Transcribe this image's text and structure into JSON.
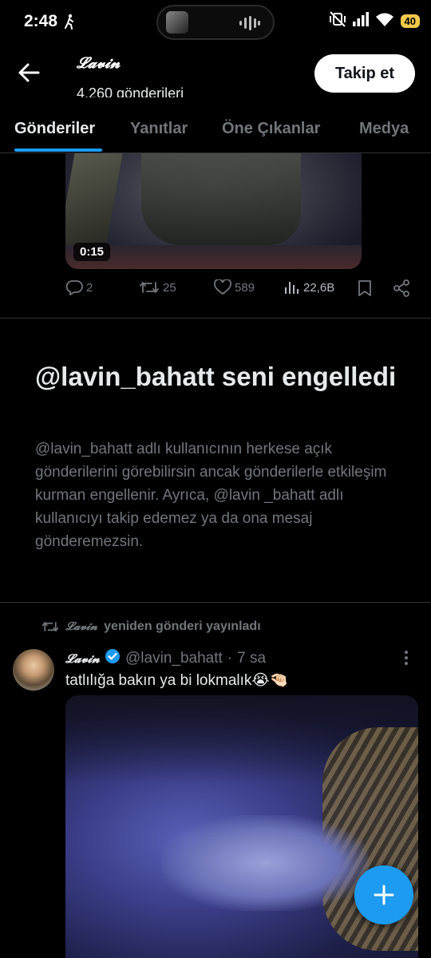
{
  "status_bar": {
    "time": "2:48",
    "battery": "40"
  },
  "header": {
    "profile_name": "𝓛𝓪𝓿𝓲𝓷",
    "posts_count": "4.260 gönderileri",
    "follow_label": "Takip et"
  },
  "tabs": [
    {
      "label": "Gönderiler",
      "active": true
    },
    {
      "label": "Yanıtlar",
      "active": false
    },
    {
      "label": "Öne Çıkanlar",
      "active": false
    },
    {
      "label": "Medya",
      "active": false
    }
  ],
  "post1": {
    "video_duration": "0:15",
    "replies": "2",
    "reposts": "25",
    "likes": "589",
    "views": "22,6B"
  },
  "blocked_notice": {
    "title": "@lavin_bahatt seni engelledi",
    "description": "@lavin_bahatt adlı kullanıcının herkese açık gönderilerini görebilirsin ancak gönderilerle etkileşim kurman engellenir. Ayrıca, @lavin _bahatt adlı kullanıcıyı takip edemez ya da ona mesaj gönderemezsin."
  },
  "post2": {
    "repost_by_name": "𝓛𝓪𝓿𝓲𝓷",
    "repost_label": "yeniden gönderi yayınladı",
    "author_name": "𝓛𝓪𝓿𝓲𝓷",
    "handle": "@lavin_bahatt",
    "separator": "·",
    "time": "7 sa",
    "text": "tatlılığa bakın ya bi lokmalık😭🤏🏻"
  },
  "colors": {
    "accent": "#1d9bf0",
    "muted": "#71767b",
    "background": "#000000"
  }
}
